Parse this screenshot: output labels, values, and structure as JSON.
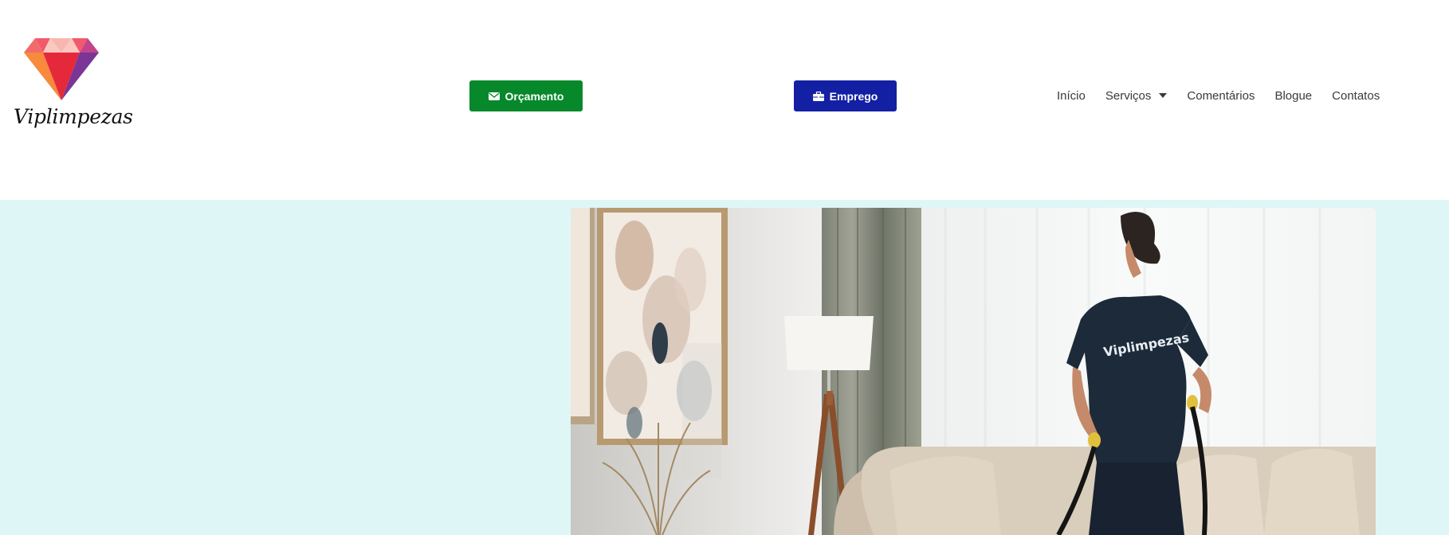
{
  "brand": {
    "name": "Viplimpezas",
    "logo_icon": "diamond-icon",
    "colors": {
      "pink": "#f15a6a",
      "red": "#e5293a",
      "orange": "#f78a3c",
      "purple": "#7a3596",
      "light_pink": "#f8b7ae"
    }
  },
  "header": {
    "quote_button": {
      "label": "Orçamento",
      "icon": "envelope-icon",
      "color": "#06882b"
    },
    "job_button": {
      "label": "Emprego",
      "icon": "briefcase-icon",
      "color": "#1320a3"
    }
  },
  "nav": {
    "items": [
      {
        "label": "Início"
      },
      {
        "label": "Serviços",
        "has_dropdown": true
      },
      {
        "label": "Comentários"
      },
      {
        "label": "Blogue"
      },
      {
        "label": "Contatos"
      }
    ]
  },
  "hero": {
    "background_color": "#dff6f7",
    "image": {
      "description_hidden": true,
      "shirt_text": "Viplimpezas"
    }
  }
}
